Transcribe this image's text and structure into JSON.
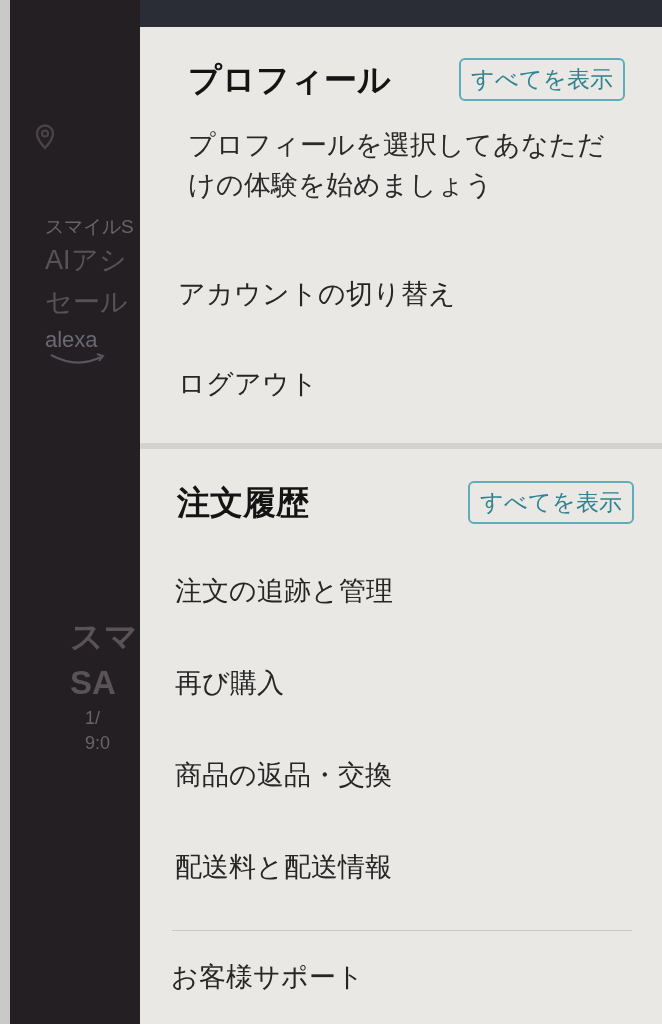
{
  "backdrop": {
    "promos": [
      {
        "lines": [
          {
            "kind": "label",
            "text": "スマイルS"
          },
          {
            "kind": "headline",
            "text": "AIアシ"
          },
          {
            "kind": "headline",
            "text": "セール"
          },
          {
            "kind": "logo",
            "text": "alexa"
          }
        ]
      },
      {
        "lines": [
          {
            "kind": "headline",
            "text": "スマ"
          },
          {
            "kind": "headline",
            "text": "SA"
          },
          {
            "kind": "label",
            "text": "1/"
          },
          {
            "kind": "label",
            "text": "9:0"
          }
        ]
      }
    ]
  },
  "menu": {
    "sections": [
      {
        "title": "プロフィール",
        "see_all": "すべてを表示",
        "description": "プロフィールを選択してあなただけの体験を始めましょう",
        "items": [
          "アカウントの切り替え",
          "ログアウト"
        ]
      },
      {
        "title": "注文履歴",
        "see_all": "すべてを表示",
        "items": [
          "注文の追跡と管理",
          "再び購入",
          "商品の返品・交換",
          "配送料と配送情報"
        ]
      }
    ],
    "footer_items": [
      "お客様サポート"
    ]
  }
}
